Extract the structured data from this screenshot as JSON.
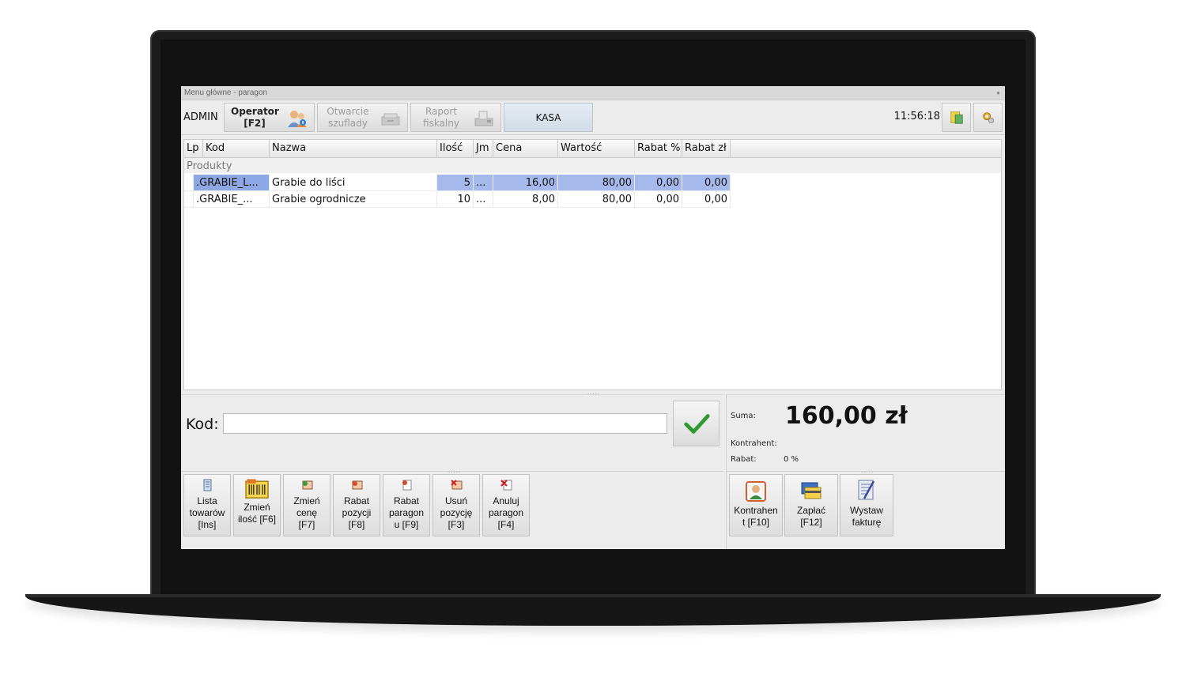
{
  "window": {
    "title": "Menu główne - paragon"
  },
  "toolbar": {
    "user": "ADMIN",
    "operator_line1": "Operator",
    "operator_line2": "[F2]",
    "drawer_line1": "Otwarcie",
    "drawer_line2": "szuflady",
    "report_line1": "Raport",
    "report_line2": "fiskalny",
    "kasa": "KASA",
    "clock": "11:56:18"
  },
  "grid": {
    "columns": [
      "Lp",
      "Kod",
      "Nazwa",
      "Ilość",
      "Jm",
      "Cena",
      "Wartość",
      "Rabat %",
      "Rabat zł"
    ],
    "group": "Produkty",
    "rows": [
      {
        "lp": ".",
        "kod": "GRABIE_L...",
        "nazwa": "Grabie do liści",
        "ilosc": "5",
        "jm": "...",
        "cena": "16,00",
        "wartosc": "80,00",
        "rabat_pct": "0,00",
        "rabat_zl": "0,00"
      },
      {
        "lp": ".",
        "kod": "GRABIE_...",
        "nazwa": "Grabie ogrodnicze",
        "ilosc": "10",
        "jm": "...",
        "cena": "8,00",
        "wartosc": "80,00",
        "rabat_pct": "0,00",
        "rabat_zl": "0,00"
      }
    ]
  },
  "entry": {
    "kod_label": "Kod:",
    "kod_value": ""
  },
  "summary": {
    "suma_label": "Suma:",
    "suma_value": "160,00 zł",
    "kontrahent_label": "Kontrahent:",
    "rabat_label": "Rabat:",
    "rabat_value": "0 %"
  },
  "actions": [
    {
      "l1": "Lista",
      "l2": "towarów",
      "l3": "[Ins]",
      "icon": "list-icon"
    },
    {
      "l1": "Zmień",
      "l2": "ilość [F6]",
      "l3": "",
      "icon": "quantity-icon"
    },
    {
      "l1": "Zmień",
      "l2": "cenę",
      "l3": "[F7]",
      "icon": "price-icon"
    },
    {
      "l1": "Rabat",
      "l2": "pozycji",
      "l3": "[F8]",
      "icon": "item-discount-icon"
    },
    {
      "l1": "Rabat",
      "l2": "paragon",
      "l3": "u [F9]",
      "icon": "receipt-discount-icon"
    },
    {
      "l1": "Usuń",
      "l2": "pozycję",
      "l3": "[F3]",
      "icon": "delete-item-icon"
    },
    {
      "l1": "Anuluj",
      "l2": "paragon",
      "l3": "[F4]",
      "icon": "cancel-receipt-icon"
    }
  ],
  "actions_right": [
    {
      "l1": "Kontrahen",
      "l2": "t [F10]",
      "icon": "contractor-icon"
    },
    {
      "l1": "Zapłać",
      "l2": "[F12]",
      "icon": "pay-icon"
    },
    {
      "l1": "Wystaw",
      "l2": "fakturę",
      "icon": "invoice-icon"
    }
  ]
}
